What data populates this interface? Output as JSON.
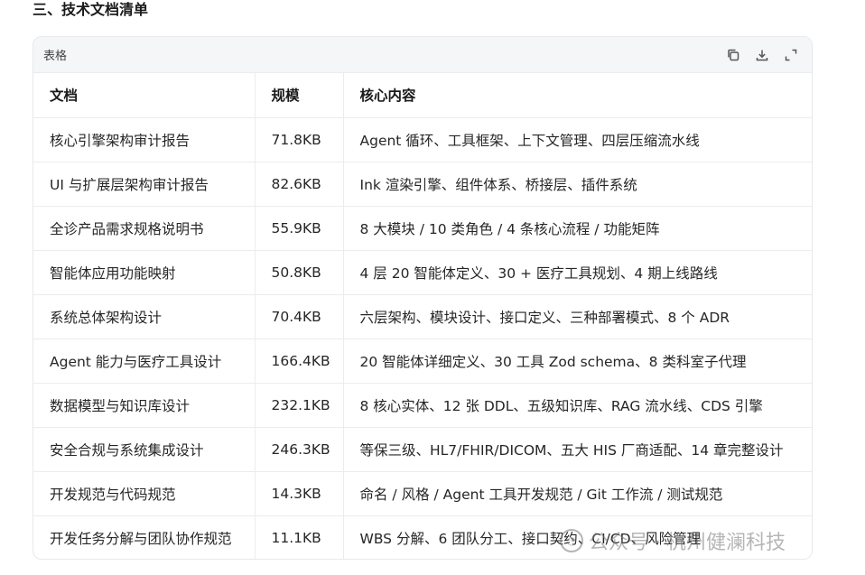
{
  "section": {
    "title": "三、技术文档清单"
  },
  "table_card": {
    "label": "表格",
    "tools": [
      {
        "name": "copy-icon"
      },
      {
        "name": "download-icon"
      },
      {
        "name": "expand-icon"
      }
    ],
    "columns": [
      "文档",
      "规模",
      "核心内容"
    ],
    "rows": [
      {
        "doc": "核心引擎架构审计报告",
        "size": "71.8KB",
        "content": "Agent 循环、工具框架、上下文管理、四层压缩流水线"
      },
      {
        "doc": "UI 与扩展层架构审计报告",
        "size": "82.6KB",
        "content": "Ink 渲染引擎、组件体系、桥接层、插件系统"
      },
      {
        "doc": "全诊产品需求规格说明书",
        "size": "55.9KB",
        "content": "8 大模块 / 10 类角色 / 4 条核心流程 / 功能矩阵"
      },
      {
        "doc": "智能体应用功能映射",
        "size": "50.8KB",
        "content": "4 层 20 智能体定义、30 + 医疗工具规划、4 期上线路线"
      },
      {
        "doc": "系统总体架构设计",
        "size": "70.4KB",
        "content": "六层架构、模块设计、接口定义、三种部署模式、8 个 ADR"
      },
      {
        "doc": "Agent 能力与医疗工具设计",
        "size": "166.4KB",
        "content": "20 智能体详细定义、30 工具 Zod schema、8 类科室子代理"
      },
      {
        "doc": "数据模型与知识库设计",
        "size": "232.1KB",
        "content": "8 核心实体、12 张 DDL、五级知识库、RAG 流水线、CDS 引擎"
      },
      {
        "doc": "安全合规与系统集成设计",
        "size": "246.3KB",
        "content": "等保三级、HL7/FHIR/DICOM、五大 HIS 厂商适配、14 章完整设计"
      },
      {
        "doc": "开发规范与代码规范",
        "size": "14.3KB",
        "content": "命名 / 风格 / Agent 工具开发规范 / Git 工作流 / 测试规范"
      },
      {
        "doc": "开发任务分解与团队协作规范",
        "size": "11.1KB",
        "content": "WBS 分解、6 团队分工、接口契约、CI/CD、风险管理"
      }
    ]
  },
  "watermark": {
    "prefix": "公众号 · ",
    "text": "杭州健澜科技"
  }
}
